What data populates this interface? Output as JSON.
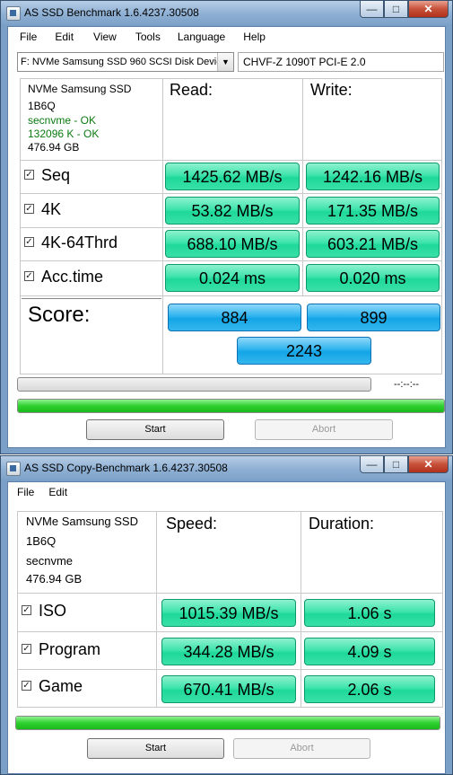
{
  "window1": {
    "title": "AS SSD Benchmark 1.6.4237.30508",
    "menu": [
      "File",
      "Edit",
      "View",
      "Tools",
      "Language",
      "Help"
    ],
    "drive_select": "F: NVMe Samsung SSD 960 SCSI Disk Devic",
    "system_info": "CHVF-Z 1090T PCI-E 2.0",
    "drive_info": {
      "model": "NVMe Samsung SSD",
      "firmware": "1B6Q",
      "driver": "secnvme - OK",
      "alignment": "132096 K - OK",
      "size": "476.94 GB"
    },
    "headers": {
      "read": "Read:",
      "write": "Write:"
    },
    "rows": [
      {
        "label": "Seq",
        "read": "1425.62 MB/s",
        "write": "1242.16 MB/s",
        "checked": true
      },
      {
        "label": "4K",
        "read": "53.82 MB/s",
        "write": "171.35 MB/s",
        "checked": true
      },
      {
        "label": "4K-64Thrd",
        "read": "688.10 MB/s",
        "write": "603.21 MB/s",
        "checked": true
      },
      {
        "label": "Acc.time",
        "read": "0.024 ms",
        "write": "0.020 ms",
        "checked": true
      }
    ],
    "score": {
      "label": "Score:",
      "read": "884",
      "write": "899",
      "total": "2243"
    },
    "time_display": "--:--:--",
    "test_progress": 0,
    "overall_progress": 1.0,
    "start_label": "Start",
    "abort_label": "Abort"
  },
  "window2": {
    "title": "AS SSD Copy-Benchmark 1.6.4237.30508",
    "menu": [
      "File",
      "Edit"
    ],
    "drive_info": {
      "model": "NVMe Samsung SSD",
      "firmware": "1B6Q",
      "driver": "secnvme",
      "size": "476.94 GB"
    },
    "headers": {
      "speed": "Speed:",
      "duration": "Duration:"
    },
    "rows": [
      {
        "label": "ISO",
        "speed": "1015.39 MB/s",
        "duration": "1.06 s",
        "checked": true
      },
      {
        "label": "Program",
        "speed": "344.28 MB/s",
        "duration": "4.09 s",
        "checked": true
      },
      {
        "label": "Game",
        "speed": "670.41 MB/s",
        "duration": "2.06 s",
        "checked": true
      }
    ],
    "progress": 1.0,
    "start_label": "Start",
    "abort_label": "Abort"
  },
  "colors": {
    "result_green": "#3fe3ab",
    "score_blue": "#2eb3ee",
    "progress_green": "#2ed12e",
    "ok_text": "#0b7a10"
  },
  "caption_icons": [
    "minimize-icon",
    "maximize-icon",
    "close-icon"
  ]
}
